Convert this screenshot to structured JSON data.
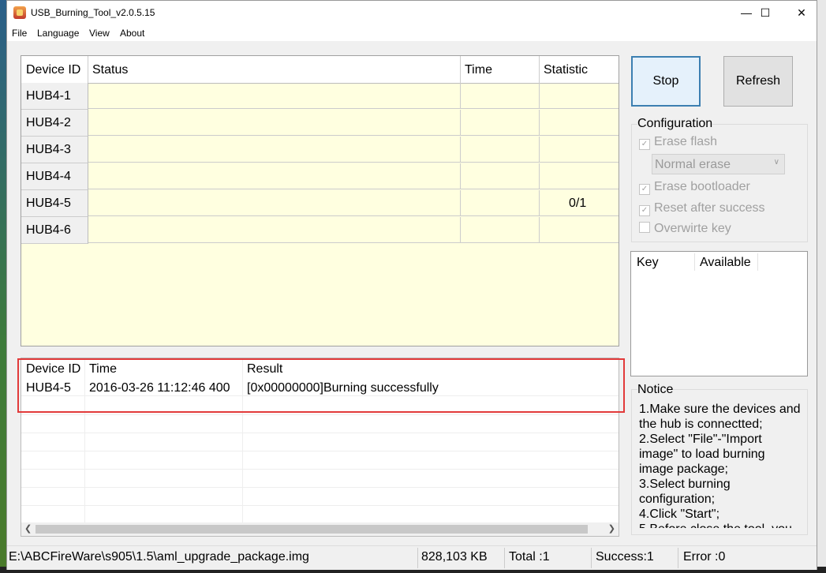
{
  "window": {
    "title": "USB_Burning_Tool_v2.0.5.15"
  },
  "window_controls": {
    "minimize": "—",
    "maximize": "☐",
    "close": "✕"
  },
  "menu": [
    "File",
    "Language",
    "View",
    "About"
  ],
  "device_table": {
    "columns": [
      "Device ID",
      "Status",
      "Time",
      "Statistic"
    ],
    "rows": [
      {
        "id": "HUB4-1",
        "statistic": ""
      },
      {
        "id": "HUB4-2",
        "statistic": ""
      },
      {
        "id": "HUB4-3",
        "statistic": ""
      },
      {
        "id": "HUB4-4",
        "statistic": ""
      },
      {
        "id": "HUB4-5",
        "statistic": "0/1"
      },
      {
        "id": "HUB4-6",
        "statistic": ""
      }
    ]
  },
  "log_table": {
    "columns": [
      "Device ID",
      "Time",
      "Result"
    ],
    "rows": [
      {
        "device": "HUB4-5",
        "time": "2016-03-26 11:12:46 400",
        "result": "[0x00000000]Burning successfully"
      }
    ]
  },
  "buttons": {
    "stop": "Stop",
    "refresh": "Refresh"
  },
  "configuration": {
    "label": "Configuration",
    "erase_flash": "Erase flash",
    "erase_mode": "Normal erase",
    "erase_bootloader": "Erase bootloader",
    "reset_after_success": "Reset after success",
    "overwrite_key": "Overwirte key"
  },
  "key_list": {
    "columns": [
      "Key",
      "Available"
    ]
  },
  "notice": {
    "label": "Notice",
    "text": "1.Make sure the devices and the hub is connectted;\n2.Select \"File\"-\"Import image\" to load burning image package;\n3.Select burning configuration;\n4.Click \"Start\";\n5.Before close the tool, you"
  },
  "status_bar": {
    "path": "E:\\ABCFireWare\\s905\\1.5\\aml_upgrade_package.img",
    "size": "828,103 KB",
    "total": "Total :1",
    "success": "Success:1",
    "error": "Error :0"
  },
  "colors": {
    "grid_bg": "#ffffe0",
    "highlight": "#e23a3a",
    "default_button_border": "#3c7fb1"
  }
}
